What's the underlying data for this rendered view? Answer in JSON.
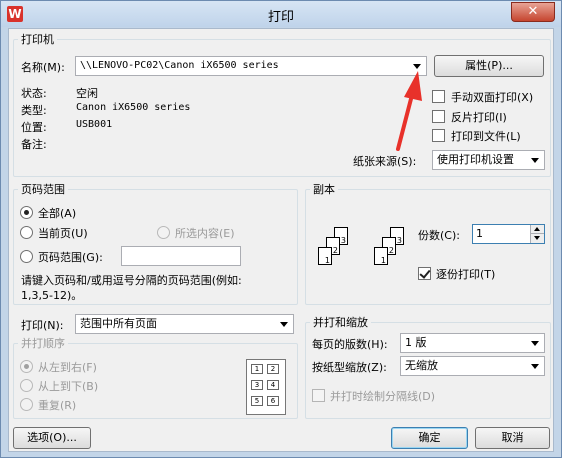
{
  "window": {
    "title": "打印",
    "close_glyph": "✕",
    "app_icon_letter": "W"
  },
  "printer": {
    "legend": "打印机",
    "name_label": "名称(M):",
    "name_value": "\\\\LENOVO-PC02\\Canon iX6500 series",
    "properties_button": "属性(P)...",
    "status_label": "状态:",
    "status_value": "空闲",
    "type_label": "类型:",
    "type_value": "Canon iX6500 series",
    "location_label": "位置:",
    "location_value": "USB001",
    "comment_label": "备注:",
    "manual_duplex": "手动双面打印(X)",
    "reverse_print": "反片打印(I)",
    "print_to_file": "打印到文件(L)",
    "paper_source_label": "纸张来源(S):",
    "paper_source_value": "使用打印机设置"
  },
  "page_range": {
    "legend": "页码范围",
    "all": "全部(A)",
    "current": "当前页(U)",
    "selection": "所选内容(E)",
    "range": "页码范围(G):",
    "range_value": "",
    "hint_line1": "请键入页码和/或用逗号分隔的页码范围(例如:",
    "hint_line2": "1,3,5-12)。"
  },
  "copies": {
    "legend": "副本",
    "count_label": "份数(C):",
    "count_value": "1",
    "collate": "逐份打印(T)"
  },
  "print_what": {
    "label": "打印(N):",
    "value": "范围中所有页面"
  },
  "order": {
    "legend": "并打顺序",
    "ltr": "从左到右(F)",
    "ttb": "从上到下(B)",
    "repeat": "重复(R)"
  },
  "zoom": {
    "legend": "并打和缩放",
    "pages_per_sheet_label": "每页的版数(H):",
    "pages_per_sheet_value": "1 版",
    "scale_label": "按纸型缩放(Z):",
    "scale_value": "无缩放",
    "draw_borders": "并打时绘制分隔线(D)"
  },
  "footer": {
    "options_button": "选项(O)...",
    "ok_button": "确定",
    "cancel_button": "取消"
  },
  "colors": {
    "arrow_annotation": "#e8312a",
    "title_bar": "#c9dbef"
  }
}
